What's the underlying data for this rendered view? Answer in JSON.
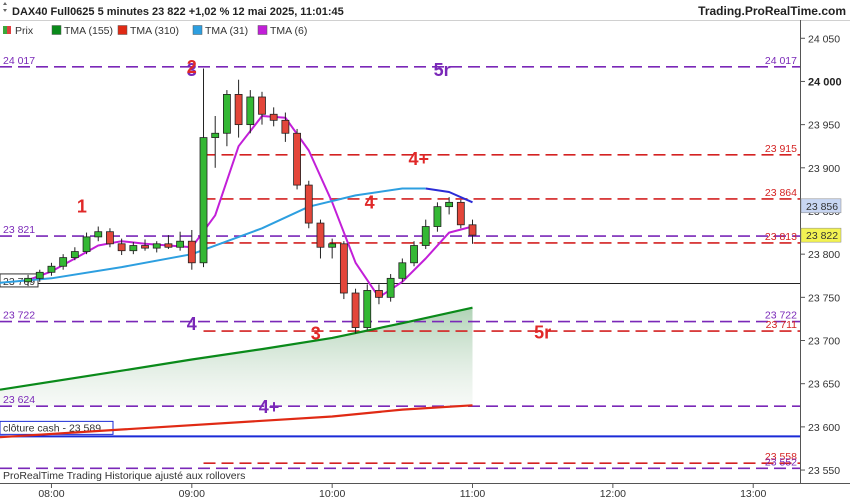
{
  "header": {
    "title": "DAX40 Full0625 5 minutes 23 822 +1,02 % 12 mai 2025, 11:01:45",
    "brand": "Trading.ProRealTime.com"
  },
  "legend": [
    {
      "label": "Prix",
      "color": "#3aa83a",
      "icon": "candle-icon"
    },
    {
      "label": "TMA (155)",
      "color": "#0a8a1a",
      "icon": "square-icon"
    },
    {
      "label": "TMA (310)",
      "color": "#e02a14",
      "icon": "square-icon"
    },
    {
      "label": "TMA (31)",
      "color": "#2d9fe0",
      "icon": "square-icon"
    },
    {
      "label": "TMA (6)",
      "color": "#c21fd8",
      "icon": "square-icon"
    }
  ],
  "footer": {
    "text": "ProRealTime Trading  Historique ajusté aux rollovers"
  },
  "chart_data": {
    "type": "candlestick",
    "instrument": "DAX40 Full0625",
    "timeframe": "5 minutes",
    "last_price": 23822,
    "change": "+1,02 %",
    "ylim": [
      23535,
      24070
    ],
    "xlim": [
      "07:38",
      "13:20"
    ],
    "y_ticks": [
      {
        "value": 23550,
        "label": "23 550"
      },
      {
        "value": 23600,
        "label": "23 600"
      },
      {
        "value": 23650,
        "label": "23 650"
      },
      {
        "value": 23700,
        "label": "23 700"
      },
      {
        "value": 23750,
        "label": "23 750"
      },
      {
        "value": 23800,
        "label": "23 800"
      },
      {
        "value": 23850,
        "label": "23 850"
      },
      {
        "value": 23900,
        "label": "23 900"
      },
      {
        "value": 23950,
        "label": "23 950"
      },
      {
        "value": 24000,
        "label": "24 000"
      },
      {
        "value": 24050,
        "label": "24 050"
      }
    ],
    "x_ticks": [
      {
        "time": "08:00",
        "label": "08:00"
      },
      {
        "time": "09:00",
        "label": "09:00"
      },
      {
        "time": "10:00",
        "label": "10:00"
      },
      {
        "time": "11:00",
        "label": "11:00"
      },
      {
        "time": "12:00",
        "label": "12:00"
      },
      {
        "time": "13:00",
        "label": "13:00"
      }
    ],
    "candles": [
      {
        "t": "07:50",
        "o": 23768,
        "h": 23776,
        "l": 23763,
        "c": 23772
      },
      {
        "t": "07:55",
        "o": 23772,
        "h": 23782,
        "l": 23768,
        "c": 23779
      },
      {
        "t": "08:00",
        "o": 23779,
        "h": 23790,
        "l": 23775,
        "c": 23786
      },
      {
        "t": "08:05",
        "o": 23786,
        "h": 23800,
        "l": 23782,
        "c": 23796
      },
      {
        "t": "08:10",
        "o": 23796,
        "h": 23808,
        "l": 23793,
        "c": 23803
      },
      {
        "t": "08:15",
        "o": 23803,
        "h": 23825,
        "l": 23800,
        "c": 23820
      },
      {
        "t": "08:20",
        "o": 23820,
        "h": 23832,
        "l": 23815,
        "c": 23826
      },
      {
        "t": "08:25",
        "o": 23826,
        "h": 23830,
        "l": 23808,
        "c": 23812
      },
      {
        "t": "08:30",
        "o": 23812,
        "h": 23818,
        "l": 23799,
        "c": 23804
      },
      {
        "t": "08:35",
        "o": 23804,
        "h": 23814,
        "l": 23800,
        "c": 23810
      },
      {
        "t": "08:40",
        "o": 23810,
        "h": 23817,
        "l": 23804,
        "c": 23807
      },
      {
        "t": "08:45",
        "o": 23807,
        "h": 23815,
        "l": 23802,
        "c": 23812
      },
      {
        "t": "08:50",
        "o": 23812,
        "h": 23822,
        "l": 23806,
        "c": 23808
      },
      {
        "t": "08:55",
        "o": 23808,
        "h": 23826,
        "l": 23804,
        "c": 23815
      },
      {
        "t": "09:00",
        "o": 23815,
        "h": 23828,
        "l": 23782,
        "c": 23790
      },
      {
        "t": "09:05",
        "o": 23790,
        "h": 24015,
        "l": 23785,
        "c": 23935
      },
      {
        "t": "09:10",
        "o": 23935,
        "h": 23960,
        "l": 23900,
        "c": 23940
      },
      {
        "t": "09:15",
        "o": 23940,
        "h": 23990,
        "l": 23925,
        "c": 23985
      },
      {
        "t": "09:20",
        "o": 23985,
        "h": 24002,
        "l": 23935,
        "c": 23950
      },
      {
        "t": "09:25",
        "o": 23950,
        "h": 23990,
        "l": 23940,
        "c": 23982
      },
      {
        "t": "09:30",
        "o": 23982,
        "h": 23988,
        "l": 23950,
        "c": 23962
      },
      {
        "t": "09:35",
        "o": 23962,
        "h": 23970,
        "l": 23948,
        "c": 23955
      },
      {
        "t": "09:40",
        "o": 23955,
        "h": 23964,
        "l": 23930,
        "c": 23940
      },
      {
        "t": "09:45",
        "o": 23940,
        "h": 23945,
        "l": 23875,
        "c": 23880
      },
      {
        "t": "09:50",
        "o": 23880,
        "h": 23885,
        "l": 23830,
        "c": 23836
      },
      {
        "t": "09:55",
        "o": 23836,
        "h": 23840,
        "l": 23795,
        "c": 23808
      },
      {
        "t": "10:00",
        "o": 23808,
        "h": 23818,
        "l": 23795,
        "c": 23812
      },
      {
        "t": "10:05",
        "o": 23812,
        "h": 23815,
        "l": 23748,
        "c": 23755
      },
      {
        "t": "10:10",
        "o": 23755,
        "h": 23760,
        "l": 23708,
        "c": 23715
      },
      {
        "t": "10:15",
        "o": 23715,
        "h": 23765,
        "l": 23712,
        "c": 23758
      },
      {
        "t": "10:20",
        "o": 23758,
        "h": 23765,
        "l": 23742,
        "c": 23750
      },
      {
        "t": "10:25",
        "o": 23750,
        "h": 23777,
        "l": 23745,
        "c": 23772
      },
      {
        "t": "10:30",
        "o": 23772,
        "h": 23795,
        "l": 23768,
        "c": 23790
      },
      {
        "t": "10:35",
        "o": 23790,
        "h": 23815,
        "l": 23786,
        "c": 23810
      },
      {
        "t": "10:40",
        "o": 23810,
        "h": 23840,
        "l": 23806,
        "c": 23832
      },
      {
        "t": "10:45",
        "o": 23832,
        "h": 23860,
        "l": 23826,
        "c": 23855
      },
      {
        "t": "10:50",
        "o": 23855,
        "h": 23866,
        "l": 23846,
        "c": 23860
      },
      {
        "t": "10:55",
        "o": 23860,
        "h": 23863,
        "l": 23830,
        "c": 23834
      },
      {
        "t": "11:00",
        "o": 23834,
        "h": 23840,
        "l": 23812,
        "c": 23822
      }
    ],
    "series": [
      {
        "name": "TMA (6)",
        "color": "#c21fd8",
        "points": [
          [
            "07:50",
            23770
          ],
          [
            "08:00",
            23780
          ],
          [
            "08:10",
            23795
          ],
          [
            "08:20",
            23810
          ],
          [
            "08:30",
            23815
          ],
          [
            "08:40",
            23812
          ],
          [
            "08:50",
            23810
          ],
          [
            "09:00",
            23808
          ],
          [
            "09:10",
            23845
          ],
          [
            "09:20",
            23925
          ],
          [
            "09:30",
            23960
          ],
          [
            "09:40",
            23958
          ],
          [
            "09:50",
            23920
          ],
          [
            "10:00",
            23860
          ],
          [
            "10:10",
            23790
          ],
          [
            "10:20",
            23750
          ],
          [
            "10:30",
            23768
          ],
          [
            "10:40",
            23795
          ],
          [
            "10:50",
            23825
          ],
          [
            "11:00",
            23832
          ]
        ]
      },
      {
        "name": "TMA (31)",
        "color": "#2d9fe0",
        "points": [
          [
            "07:38",
            23767
          ],
          [
            "08:00",
            23772
          ],
          [
            "08:30",
            23785
          ],
          [
            "09:00",
            23800
          ],
          [
            "09:30",
            23830
          ],
          [
            "09:50",
            23855
          ],
          [
            "10:10",
            23868
          ],
          [
            "10:30",
            23876
          ],
          [
            "10:40",
            23876
          ]
        ]
      },
      {
        "name": "TMA (31) projection",
        "color": "#2b2bd6",
        "points": [
          [
            "10:40",
            23876
          ],
          [
            "10:50",
            23872
          ],
          [
            "11:00",
            23860
          ]
        ]
      },
      {
        "name": "TMA (155)",
        "color": "#0a8a1a",
        "points": [
          [
            "07:38",
            23643
          ],
          [
            "08:30",
            23665
          ],
          [
            "09:00",
            23678
          ],
          [
            "09:30",
            23690
          ],
          [
            "10:00",
            23703
          ],
          [
            "10:30",
            23720
          ],
          [
            "11:00",
            23738
          ]
        ]
      },
      {
        "name": "TMA (310)",
        "color": "#e02a14",
        "points": [
          [
            "07:38",
            23588
          ],
          [
            "08:30",
            23597
          ],
          [
            "09:30",
            23607
          ],
          [
            "10:00",
            23612
          ],
          [
            "10:30",
            23620
          ],
          [
            "11:00",
            23625
          ]
        ]
      }
    ],
    "levels": [
      {
        "value": 24017,
        "label": "24 017",
        "color": "#7a28b8",
        "side": "both",
        "from": "07:38"
      },
      {
        "value": 23915,
        "label": "23 915",
        "color": "#d42222",
        "side": "right",
        "from": "09:05"
      },
      {
        "value": 23864,
        "label": "23 864",
        "color": "#d42222",
        "side": "right",
        "from": "09:05"
      },
      {
        "value": 23821,
        "label": "23 821",
        "color": "#7a28b8",
        "side": "left",
        "from": "07:38"
      },
      {
        "value": 23813,
        "label": "23 813",
        "color": "#d42222",
        "side": "right",
        "from": "09:05"
      },
      {
        "value": 23722,
        "label": "23 722",
        "color": "#7a28b8",
        "side": "both",
        "from": "07:38"
      },
      {
        "value": 23711,
        "label": "23 711",
        "color": "#d42222",
        "side": "right",
        "from": "09:05"
      },
      {
        "value": 23624,
        "label": "23 624",
        "color": "#7a28b8",
        "side": "left",
        "from": "07:38"
      },
      {
        "value": 23558,
        "label": "23 558",
        "color": "#d42222",
        "side": "right",
        "from": "09:05"
      },
      {
        "value": 23552,
        "label": "23 552",
        "color": "#7a28b8",
        "side": "right",
        "from": "07:38"
      }
    ],
    "cloture_cash": {
      "value": 23589,
      "label": "clôture cash -  23 589",
      "color": "#1a2ad6"
    },
    "last_close_line": {
      "value": 23769,
      "label": "23 769"
    },
    "price_markers": [
      {
        "value": 23856,
        "label": "23 856",
        "bg": "#c8d6f2"
      },
      {
        "value": 23822,
        "label": "23 822",
        "bg": "#f2f252"
      }
    ],
    "wave_labels": [
      {
        "text": "3",
        "color": "purple",
        "time": "09:00",
        "value": 24013
      },
      {
        "text": "2",
        "color": "red",
        "time": "09:00",
        "value": 24017
      },
      {
        "text": "5r",
        "color": "purple",
        "time": "10:47",
        "value": 24013
      },
      {
        "text": "4+",
        "color": "red",
        "time": "10:37",
        "value": 23910
      },
      {
        "text": "4",
        "color": "red",
        "time": "10:16",
        "value": 23860
      },
      {
        "text": "1",
        "color": "red",
        "time": "08:13",
        "value": 23855
      },
      {
        "text": "4",
        "color": "purple",
        "time": "09:00",
        "value": 23719
      },
      {
        "text": "3",
        "color": "red",
        "time": "09:53",
        "value": 23708
      },
      {
        "text": "5r",
        "color": "red",
        "time": "11:30",
        "value": 23709
      },
      {
        "text": "4+",
        "color": "purple",
        "time": "09:33",
        "value": 23623
      }
    ]
  }
}
